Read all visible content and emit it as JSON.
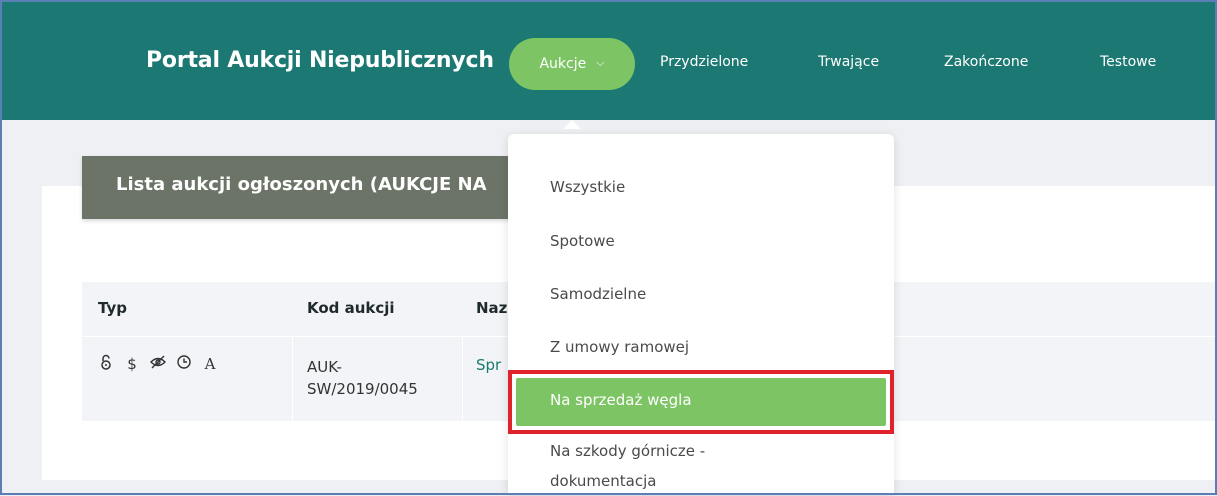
{
  "header": {
    "brand": "Portal Aukcji Niepublicznych",
    "active_menu": "Aukcje",
    "nav": [
      "Przydzielone",
      "Trwające",
      "Zakończone",
      "Testowe"
    ]
  },
  "list": {
    "title": "Lista aukcji ogłoszonych (AUKCJE NA",
    "columns": [
      "Typ",
      "Kod aukcji",
      "Naz"
    ],
    "rows": [
      {
        "type_icons": [
          "🔓",
          "$",
          "👁",
          "🕒",
          "A"
        ],
        "code_line1": "AUK-",
        "code_line2": "SW/2019/0045",
        "name": "Spr"
      }
    ]
  },
  "dropdown": {
    "items": [
      "Wszystkie",
      "Spotowe",
      "Samodzielne",
      "Z umowy ramowej",
      "Na sprzedaż węgla",
      "Na szkody górnicze -",
      "dokumentacja"
    ],
    "selected_index": 4
  },
  "colors": {
    "header": "#1c7872",
    "accent_green": "#7dc465",
    "highlight_border": "#e0232b",
    "title_bar": "#6b7467"
  }
}
